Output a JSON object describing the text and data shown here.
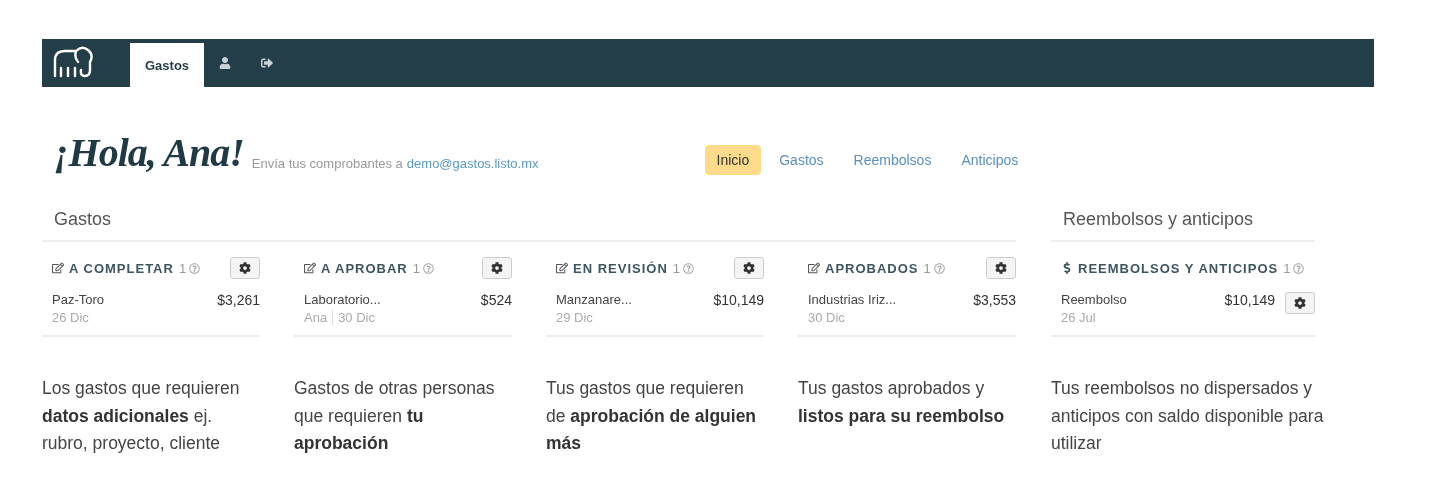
{
  "navbar": {
    "tabs": [
      {
        "kind": "text",
        "label": "Gastos",
        "selected": true
      },
      {
        "kind": "user",
        "selected": false
      },
      {
        "kind": "logout",
        "selected": false
      }
    ]
  },
  "greeting": {
    "title": "¡Hola, Ana!",
    "subtitle": "Envía tus comprobantes a",
    "email": "demo@gastos.listo.mx"
  },
  "menu": [
    {
      "label": "Inicio",
      "selected": true
    },
    {
      "label": "Gastos",
      "selected": false
    },
    {
      "label": "Reembolsos",
      "selected": false
    },
    {
      "label": "Anticipos",
      "selected": false
    }
  ],
  "sections": [
    {
      "title": "Gastos",
      "cards": [
        {
          "kind": "edit",
          "title": "A COMPLETAR",
          "count": "1",
          "item": {
            "name": "Paz-Toro",
            "amount": "$3,261",
            "meta": [
              "26 Dic"
            ]
          },
          "description": "Los gastos que requieren **datos adicionales** ej. rubro, proyecto, cliente"
        },
        {
          "kind": "edit",
          "title": "A APROBAR",
          "count": "1",
          "item": {
            "name": "Laboratorio...",
            "amount": "$524",
            "meta": [
              "Ana",
              "30 Dic"
            ]
          },
          "description": "Gastos de otras personas que requieren **tu aprobación**"
        },
        {
          "kind": "edit",
          "title": "EN REVISIÓN",
          "count": "1",
          "item": {
            "name": "Manzanare...",
            "amount": "$10,149",
            "meta": [
              "29 Dic"
            ]
          },
          "description": "Tus gastos que requieren de **aprobación de alguien más**"
        },
        {
          "kind": "edit",
          "title": "APROBADOS",
          "count": "1",
          "item": {
            "name": "Industrias Iriz...",
            "amount": "$3,553",
            "meta": [
              "30 Dic"
            ]
          },
          "description": "Tus gastos aprobados y **listos para su reembolso**"
        }
      ]
    },
    {
      "title": "Reembolsos y anticipos",
      "cards": [
        {
          "kind": "money",
          "title": "REEMBOLSOS Y ANTICIPOS",
          "count": "1",
          "item": {
            "name": "Reembolso",
            "amount": "$10,149",
            "meta": [
              "26 Jul"
            ]
          },
          "description": "Tus reembolsos no dispersados  y anticipos con saldo disponible para utilizar"
        }
      ]
    }
  ]
}
